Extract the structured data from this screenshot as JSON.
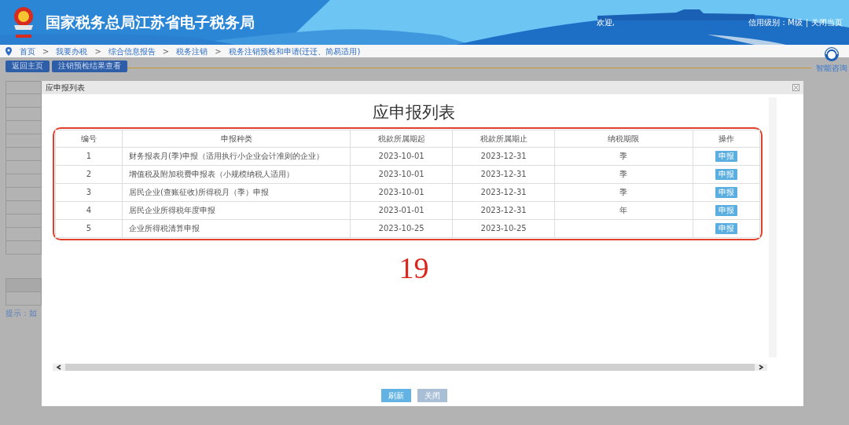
{
  "header": {
    "title": "国家税务总局江苏省电子税务局",
    "welcome": "欢迎,",
    "credit": "信用级别：M级",
    "separator": "|",
    "close_page": "关闭当页"
  },
  "breadcrumb": [
    "首页",
    "我要办税",
    "综合信息报告",
    "税务注销",
    "税务注销预检和申请(迁迁、简易适用)"
  ],
  "breadcrumb_separator": ">",
  "toolbar": [
    "返回主页",
    "注销预检结果查看"
  ],
  "help": {
    "label": "智能咨询"
  },
  "sidebar": {
    "hint": "提示：如"
  },
  "dialog": {
    "title": "应申报列表",
    "heading": "应申报列表",
    "table": {
      "columns": [
        "编号",
        "申报种类",
        "税款所属期起",
        "税款所属期止",
        "纳税期限",
        "操作"
      ],
      "rows": [
        {
          "no": "1",
          "kind_name": "财务报表月(季)申报（适用执行小企业会计准则的企业）",
          "start": "2023-10-01",
          "end": "2023-12-31",
          "period": "季",
          "action": "申报"
        },
        {
          "no": "2",
          "kind_name": "增值税及附加税费申报表（小规模纳税人适用）",
          "start": "2023-10-01",
          "end": "2023-12-31",
          "period": "季",
          "action": "申报"
        },
        {
          "no": "3",
          "kind_name": "居民企业(查账征收)所得税月（季）申报",
          "start": "2023-10-01",
          "end": "2023-12-31",
          "period": "季",
          "action": "申报"
        },
        {
          "no": "4",
          "kind_name": "居民企业所得税年度申报",
          "start": "2023-01-01",
          "end": "2023-12-31",
          "period": "年",
          "action": "申报"
        },
        {
          "no": "5",
          "kind_name": "企业所得税清算申报",
          "start": "2023-10-25",
          "end": "2023-10-25",
          "action": "申报"
        }
      ]
    },
    "count": "19",
    "buttons": [
      {
        "label": "刷新",
        "kind": "primary"
      },
      {
        "label": "关闭",
        "kind": "secondary"
      }
    ]
  }
}
